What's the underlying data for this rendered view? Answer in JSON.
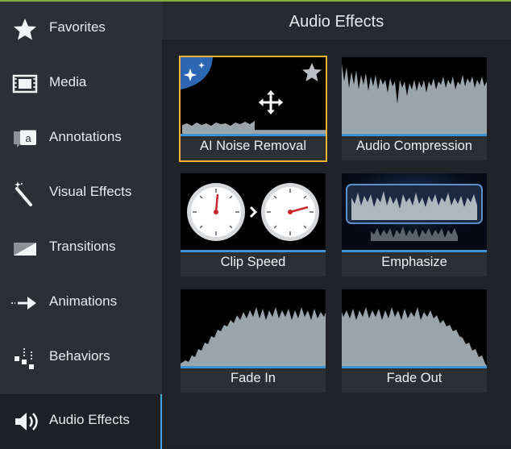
{
  "sidebar": {
    "items": [
      {
        "label": "Favorites",
        "icon": "star-icon"
      },
      {
        "label": "Media",
        "icon": "film-icon"
      },
      {
        "label": "Annotations",
        "icon": "callout-icon"
      },
      {
        "label": "Visual Effects",
        "icon": "magic-wand-icon"
      },
      {
        "label": "Transitions",
        "icon": "transition-icon"
      },
      {
        "label": "Animations",
        "icon": "arrow-motion-icon"
      },
      {
        "label": "Behaviors",
        "icon": "behaviors-icon"
      },
      {
        "label": "Audio Effects",
        "icon": "speaker-icon",
        "active": true
      }
    ]
  },
  "panel": {
    "title": "Audio Effects",
    "tiles": [
      {
        "label": "AI Noise Removal",
        "selected": true
      },
      {
        "label": "Audio Compression"
      },
      {
        "label": "Clip Speed"
      },
      {
        "label": "Emphasize"
      },
      {
        "label": "Fade In"
      },
      {
        "label": "Fade Out"
      }
    ]
  },
  "colors": {
    "accent": "#3c93d6",
    "selection": "#f2b233",
    "top_bar": "#7fae3c"
  }
}
